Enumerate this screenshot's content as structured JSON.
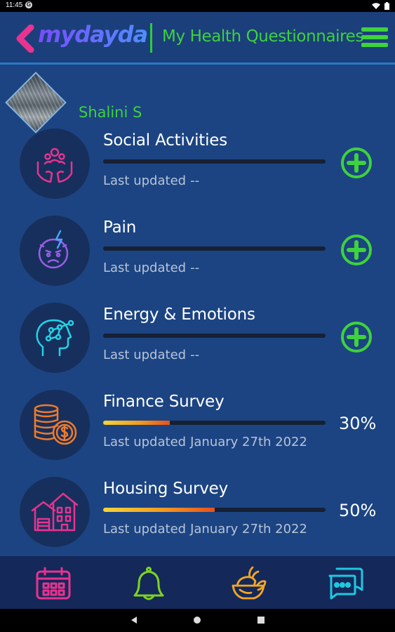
{
  "status_bar": {
    "time": "11:45",
    "g_icon": "G"
  },
  "header": {
    "logo_text": "mydayda",
    "title": "My Health Questionnaires",
    "brand_colors": {
      "accent_green": "#3ed23c",
      "logo_pink": "#e8338f",
      "logo_blue": "#5b7dff"
    }
  },
  "user": {
    "name": "Shalini S"
  },
  "questionnaires": [
    {
      "title": "Social Activities",
      "updated_label": "Last updated",
      "updated_value": "--",
      "progress": 0,
      "percent_text": "",
      "icon": "social-activities-icon"
    },
    {
      "title": "Pain",
      "updated_label": "Last updated",
      "updated_value": "--",
      "progress": 0,
      "percent_text": "",
      "icon": "pain-icon"
    },
    {
      "title": "Energy & Emotions",
      "updated_label": "Last updated",
      "updated_value": "--",
      "progress": 0,
      "percent_text": "",
      "icon": "energy-emotions-icon"
    },
    {
      "title": "Finance Survey",
      "updated_label": "Last updated",
      "updated_value": "January 27th 2022",
      "progress": 0.3,
      "percent_text": "30%",
      "icon": "finance-coins-icon"
    },
    {
      "title": "Housing Survey",
      "updated_label": "Last updated",
      "updated_value": "January 27th 2022",
      "progress": 0.5,
      "percent_text": "50%",
      "icon": "housing-icon"
    }
  ],
  "bottom_nav": [
    {
      "name": "calendar",
      "color": "#e8338f"
    },
    {
      "name": "notifications-bell",
      "color": "#7ed321"
    },
    {
      "name": "food",
      "color": "#f5a623"
    },
    {
      "name": "messages",
      "color": "#1fc8e0"
    }
  ]
}
